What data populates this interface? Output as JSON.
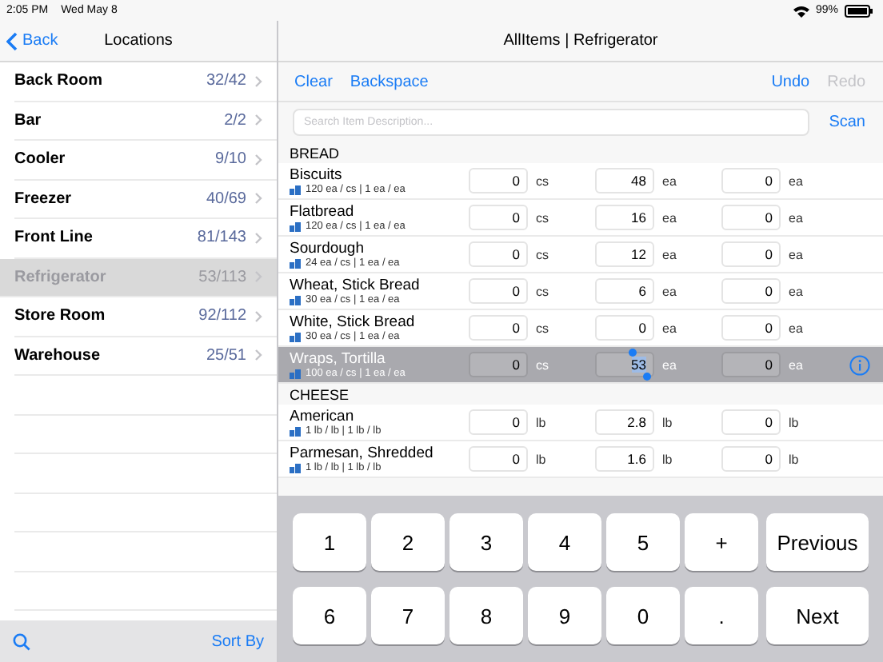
{
  "status_bar": {
    "time": "2:05 PM",
    "date": "Wed May 8",
    "battery": "99%"
  },
  "sidebar": {
    "back": "Back",
    "title": "Locations",
    "items": [
      {
        "name": "Back Room",
        "count": "32/42",
        "selected": false
      },
      {
        "name": "Bar",
        "count": "2/2",
        "selected": false
      },
      {
        "name": "Cooler",
        "count": "9/10",
        "selected": false
      },
      {
        "name": "Freezer",
        "count": "40/69",
        "selected": false
      },
      {
        "name": "Front Line",
        "count": "81/143",
        "selected": false
      },
      {
        "name": "Refrigerator",
        "count": "53/113",
        "selected": true
      },
      {
        "name": "Store Room",
        "count": "92/112",
        "selected": false
      },
      {
        "name": "Warehouse",
        "count": "25/51",
        "selected": false
      }
    ],
    "sort": "Sort By"
  },
  "main": {
    "title": "AllItems | Refrigerator",
    "toolbar": [
      {
        "label": "Clear",
        "disabled": false
      },
      {
        "label": "Backspace",
        "disabled": false
      },
      {
        "label": "Undo",
        "disabled": false
      },
      {
        "label": "Redo",
        "disabled": true
      }
    ],
    "search": {
      "placeholder": "Search Item Description..."
    },
    "scan": "Scan",
    "sections": [
      {
        "title": "BREAD",
        "items": [
          {
            "name": "Biscuits",
            "detail": "120 ea / cs | 1 ea / ea",
            "selected": false,
            "quantities": [
              {
                "value": "0",
                "unit": "cs",
                "focused": false
              },
              {
                "value": "48",
                "unit": "ea",
                "focused": false
              },
              {
                "value": "0",
                "unit": "ea",
                "focused": false
              }
            ]
          },
          {
            "name": "Flatbread",
            "detail": "120 ea / cs | 1 ea / ea",
            "selected": false,
            "quantities": [
              {
                "value": "0",
                "unit": "cs",
                "focused": false
              },
              {
                "value": "16",
                "unit": "ea",
                "focused": false
              },
              {
                "value": "0",
                "unit": "ea",
                "focused": false
              }
            ]
          },
          {
            "name": "Sourdough",
            "detail": "24 ea / cs | 1 ea / ea",
            "selected": false,
            "quantities": [
              {
                "value": "0",
                "unit": "cs",
                "focused": false
              },
              {
                "value": "12",
                "unit": "ea",
                "focused": false
              },
              {
                "value": "0",
                "unit": "ea",
                "focused": false
              }
            ]
          },
          {
            "name": "Wheat, Stick Bread",
            "detail": "30 ea / cs | 1 ea / ea",
            "selected": false,
            "quantities": [
              {
                "value": "0",
                "unit": "cs",
                "focused": false
              },
              {
                "value": "6",
                "unit": "ea",
                "focused": false
              },
              {
                "value": "0",
                "unit": "ea",
                "focused": false
              }
            ]
          },
          {
            "name": "White, Stick Bread",
            "detail": "30 ea / cs | 1 ea / ea",
            "selected": false,
            "quantities": [
              {
                "value": "0",
                "unit": "cs",
                "focused": false
              },
              {
                "value": "0",
                "unit": "ea",
                "focused": false
              },
              {
                "value": "0",
                "unit": "ea",
                "focused": false
              }
            ]
          },
          {
            "name": "Wraps, Tortilla",
            "detail": "100 ea / cs | 1 ea / ea",
            "selected": true,
            "quantities": [
              {
                "value": "0",
                "unit": "cs",
                "focused": false
              },
              {
                "value": "53",
                "unit": "ea",
                "focused": true
              },
              {
                "value": "0",
                "unit": "ea",
                "focused": false
              }
            ]
          }
        ]
      },
      {
        "title": "CHEESE",
        "items": [
          {
            "name": "American",
            "detail": "1 lb / lb | 1 lb / lb",
            "selected": false,
            "quantities": [
              {
                "value": "0",
                "unit": "lb",
                "focused": false
              },
              {
                "value": "2.8",
                "unit": "lb",
                "focused": false
              },
              {
                "value": "0",
                "unit": "lb",
                "focused": false
              }
            ]
          },
          {
            "name": "Parmesan, Shredded",
            "detail": "1 lb / lb | 1 lb / lb",
            "selected": false,
            "quantities": [
              {
                "value": "0",
                "unit": "lb",
                "focused": false
              },
              {
                "value": "1.6",
                "unit": "lb",
                "focused": false
              },
              {
                "value": "0",
                "unit": "lb",
                "focused": false
              }
            ]
          }
        ]
      }
    ]
  },
  "keypad": [
    [
      {
        "label": "1",
        "kind": "digit"
      },
      {
        "label": "2",
        "kind": "digit"
      },
      {
        "label": "3",
        "kind": "digit"
      },
      {
        "label": "4",
        "kind": "digit"
      },
      {
        "label": "5",
        "kind": "digit"
      },
      {
        "label": "+",
        "kind": "digit"
      },
      {
        "label": "Previous",
        "kind": "wide"
      }
    ],
    [
      {
        "label": "6",
        "kind": "digit"
      },
      {
        "label": "7",
        "kind": "digit"
      },
      {
        "label": "8",
        "kind": "digit"
      },
      {
        "label": "9",
        "kind": "digit"
      },
      {
        "label": "0",
        "kind": "digit"
      },
      {
        "label": ".",
        "kind": "digit"
      },
      {
        "label": "Next",
        "kind": "wide"
      }
    ]
  ]
}
